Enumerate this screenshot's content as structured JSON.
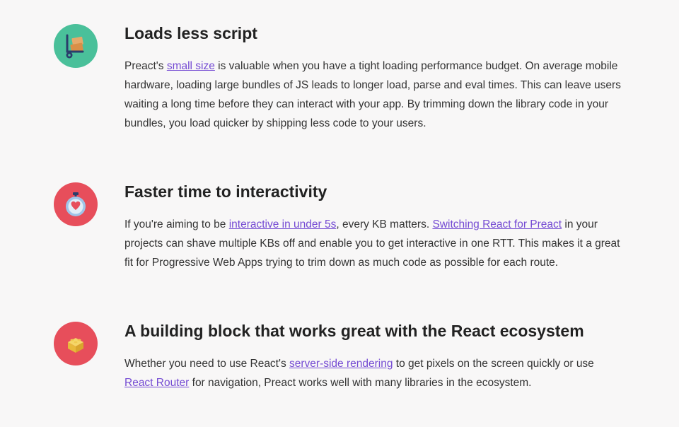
{
  "sections": [
    {
      "heading": "Loads less script",
      "p_before": "Preact's ",
      "link1_text": "small size",
      "p_mid1": " is valuable when you have a tight loading performance budget. On average mobile hardware, loading large bundles of JS leads to longer load, parse and eval times. This can leave users waiting a long time before they can interact with your app. By trimming down the library code in your bundles, you load quicker by shipping less code to your users.",
      "link2_text": "",
      "p_mid2": "",
      "link3_text": "",
      "p_after": ""
    },
    {
      "heading": "Faster time to interactivity",
      "p_before": "If you're aiming to be ",
      "link1_text": "interactive in under 5s",
      "p_mid1": ", every KB matters. ",
      "link2_text": "Switching React for Preact",
      "p_mid2": " in your projects can shave multiple KBs off and enable you to get interactive in one RTT. This makes it a great fit for Progressive Web Apps trying to trim down as much code as possible for each route.",
      "link3_text": "",
      "p_after": ""
    },
    {
      "heading": "A building block that works great with the React ecosystem",
      "p_before": "Whether you need to use React's ",
      "link1_text": "server-side rendering",
      "p_mid1": " to get pixels on the screen quickly or use ",
      "link2_text": "React Router",
      "p_mid2": " for navigation, Preact works well with many libraries in the ecosystem.",
      "link3_text": "",
      "p_after": ""
    }
  ]
}
